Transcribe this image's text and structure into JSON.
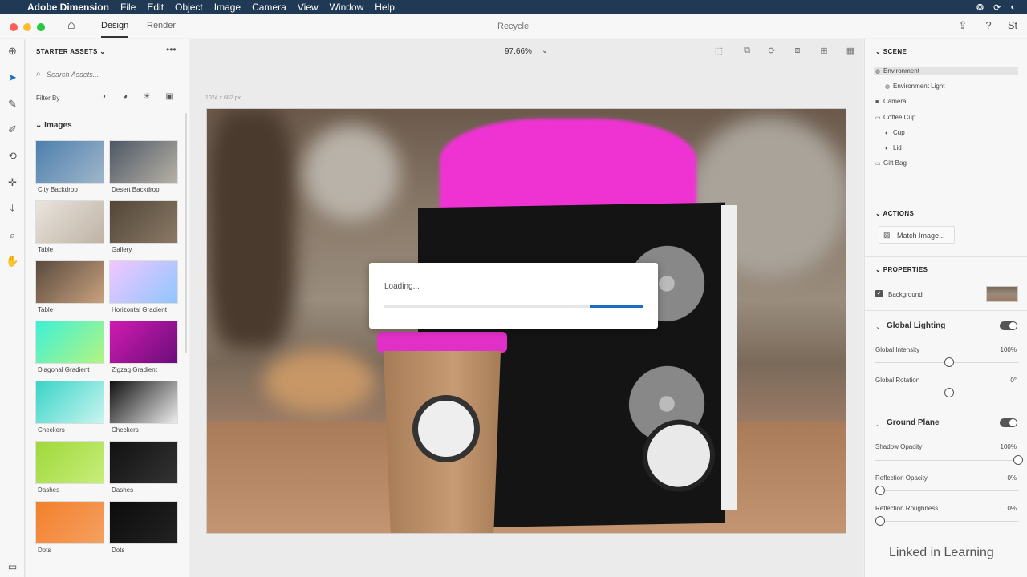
{
  "menubar": {
    "app_name": "Adobe Dimension",
    "items": [
      "File",
      "Edit",
      "Object",
      "Image",
      "Camera",
      "View",
      "Window",
      "Help"
    ]
  },
  "titlebar": {
    "tabs": [
      "Design",
      "Render"
    ],
    "active_tab": "Design",
    "document_title": "Recycle"
  },
  "left_panel": {
    "header": "STARTER ASSETS",
    "search_placeholder": "Search Assets...",
    "filter_label": "Filter By",
    "images_section": "Images",
    "assets": [
      {
        "label": "City Backdrop",
        "colors": [
          "#4d7fae",
          "#9fb6c9"
        ]
      },
      {
        "label": "Desert Backdrop",
        "colors": [
          "#4d5865",
          "#b7b1a6"
        ]
      },
      {
        "label": "Table",
        "colors": [
          "#e9e4dd",
          "#bfb3a5"
        ]
      },
      {
        "label": "Gallery",
        "colors": [
          "#524638",
          "#8a7966"
        ]
      },
      {
        "label": "Table",
        "colors": [
          "#5a4a3e",
          "#c9a27e"
        ]
      },
      {
        "label": "Horizontal Gradient",
        "colors": [
          "#f2c6ff",
          "#8fc6ff"
        ]
      },
      {
        "label": "Diagonal Gradient",
        "colors": [
          "#3ef0d6",
          "#b3f582"
        ]
      },
      {
        "label": "Zigzag Gradient",
        "colors": [
          "#d01bb1",
          "#6a0d7a"
        ]
      },
      {
        "label": "Checkers",
        "colors": [
          "#39d4c6",
          "#c9f5f0"
        ]
      },
      {
        "label": "Checkers",
        "colors": [
          "#111111",
          "#eeeeee"
        ]
      },
      {
        "label": "Dashes",
        "colors": [
          "#9fd83a",
          "#c7ee7a"
        ]
      },
      {
        "label": "Dashes",
        "colors": [
          "#111111",
          "#333333"
        ]
      },
      {
        "label": "Dots",
        "colors": [
          "#f2802c",
          "#f5a060"
        ]
      },
      {
        "label": "Dots",
        "colors": [
          "#0c0c0c",
          "#222222"
        ]
      }
    ]
  },
  "canvas": {
    "zoom": "97.66%",
    "dimensions": "1024 x 682 px",
    "loading_text": "Loading...",
    "loading_progress": 0.2
  },
  "right_panel": {
    "scene_header": "SCENE",
    "scene_items": [
      {
        "label": "Environment",
        "level": 0,
        "selected": true,
        "icon": "globe-icon"
      },
      {
        "label": "Environment Light",
        "level": 1,
        "selected": false,
        "icon": "globe-icon"
      },
      {
        "label": "Camera",
        "level": 0,
        "selected": false,
        "icon": "camera-icon"
      },
      {
        "label": "Coffee Cup",
        "level": 0,
        "selected": false,
        "icon": "folder-icon"
      },
      {
        "label": "Cup",
        "level": 1,
        "selected": false,
        "icon": "material-icon"
      },
      {
        "label": "Lid",
        "level": 1,
        "selected": false,
        "icon": "material-icon"
      },
      {
        "label": "Gift Bag",
        "level": 0,
        "selected": false,
        "icon": "folder-icon"
      }
    ],
    "actions_header": "ACTIONS",
    "match_image_label": "Match Image...",
    "properties_header": "PROPERTIES",
    "background_label": "Background",
    "global_lighting": {
      "title": "Global Lighting",
      "intensity_label": "Global Intensity",
      "intensity_value": "100%",
      "intensity_level": 0.5,
      "rotation_label": "Global Rotation",
      "rotation_value": "0°",
      "rotation_level": 0.5
    },
    "ground_plane": {
      "title": "Ground Plane",
      "shadow_label": "Shadow Opacity",
      "shadow_value": "100%",
      "shadow_level": 1.0,
      "reflection_label": "Reflection Opacity",
      "reflection_value": "0%",
      "reflection_level": 0.0,
      "roughness_label": "Reflection Roughness",
      "roughness_value": "0%",
      "roughness_level": 0.0
    }
  },
  "watermark": "Linked in Learning"
}
